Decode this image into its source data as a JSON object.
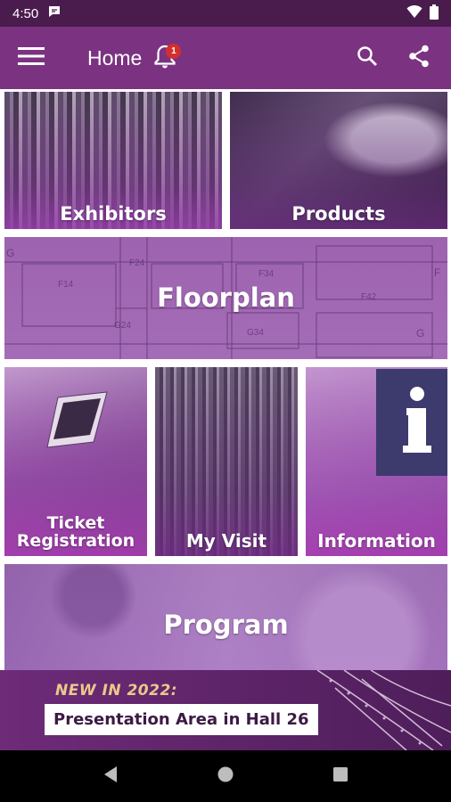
{
  "status_bar": {
    "time": "4:50",
    "icons": [
      "message-icon",
      "wifi-icon",
      "battery-icon"
    ]
  },
  "app_bar": {
    "title": "Home",
    "notification_count": "1",
    "icons": [
      "menu-icon",
      "bell-icon",
      "search-icon",
      "share-icon"
    ]
  },
  "tiles": {
    "exhibitors": "Exhibitors",
    "products": "Products",
    "floorplan": "Floorplan",
    "ticket_line1": "Ticket",
    "ticket_line2": "Registration",
    "my_visit": "My Visit",
    "information": "Information",
    "program": "Program"
  },
  "floorplan_map": {
    "labels": [
      "G",
      "F24",
      "F34",
      "F",
      "F14",
      "F42",
      "G24",
      "G34",
      "G"
    ]
  },
  "banner": {
    "kicker": "NEW IN 2022:",
    "headline": "Presentation Area in Hall 26"
  },
  "navigation": {
    "icons": [
      "back-icon",
      "home-icon",
      "recents-icon"
    ]
  },
  "colors": {
    "status_bar": "#4a1c4e",
    "app_bar": "#7b3381",
    "badge": "#d32f2f",
    "banner_kicker": "#e9c98a"
  }
}
